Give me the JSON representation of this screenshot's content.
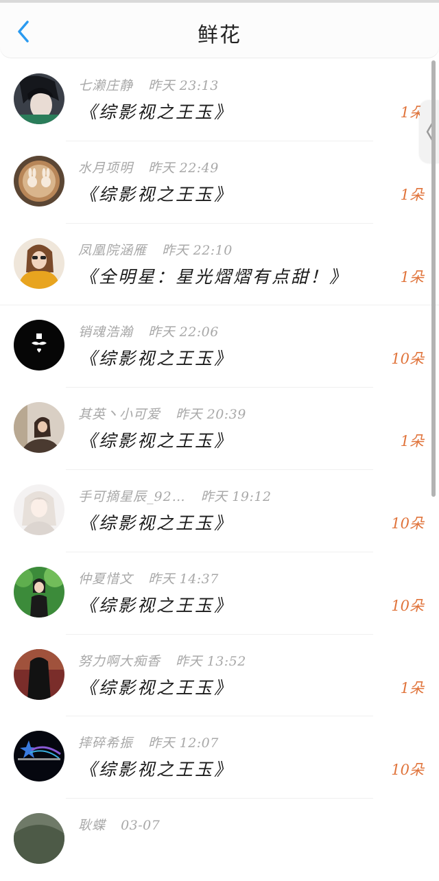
{
  "header": {
    "title": "鲜花",
    "back_icon": "chevron-left-icon",
    "accent_color": "#2a9af0"
  },
  "count_color": "#e0733a",
  "rows": [
    {
      "name": "七濑庄静",
      "time": "昨天 23:13",
      "book": "《综影视之王玉》",
      "count": "1朵"
    },
    {
      "name": "水月项明",
      "time": "昨天 22:49",
      "book": "《综影视之王玉》",
      "count": "1朵"
    },
    {
      "name": "凤凰院涵雁",
      "time": "昨天 22:10",
      "book": "《全明星：星光熠熠有点甜！》",
      "count": "1朵"
    },
    {
      "name": "销魂浩瀚",
      "time": "昨天 22:06",
      "book": "《综影视之王玉》",
      "count": "10朵"
    },
    {
      "name": "其英丶小可爱",
      "time": "昨天 20:39",
      "book": "《综影视之王玉》",
      "count": "1朵"
    },
    {
      "name": "手可摘星辰_92…",
      "time": "昨天 19:12",
      "book": "《综影视之王玉》",
      "count": "10朵"
    },
    {
      "name": "仲夏惜文",
      "time": "昨天 14:37",
      "book": "《综影视之王玉》",
      "count": "10朵"
    },
    {
      "name": "努力啊大痴香",
      "time": "昨天 13:52",
      "book": "《综影视之王玉》",
      "count": "1朵"
    },
    {
      "name": "摔碎希振",
      "time": "昨天 12:07",
      "book": "《综影视之王玉》",
      "count": "10朵"
    },
    {
      "name": "耿蝶",
      "time": "03-07",
      "book": "",
      "count": ""
    }
  ]
}
